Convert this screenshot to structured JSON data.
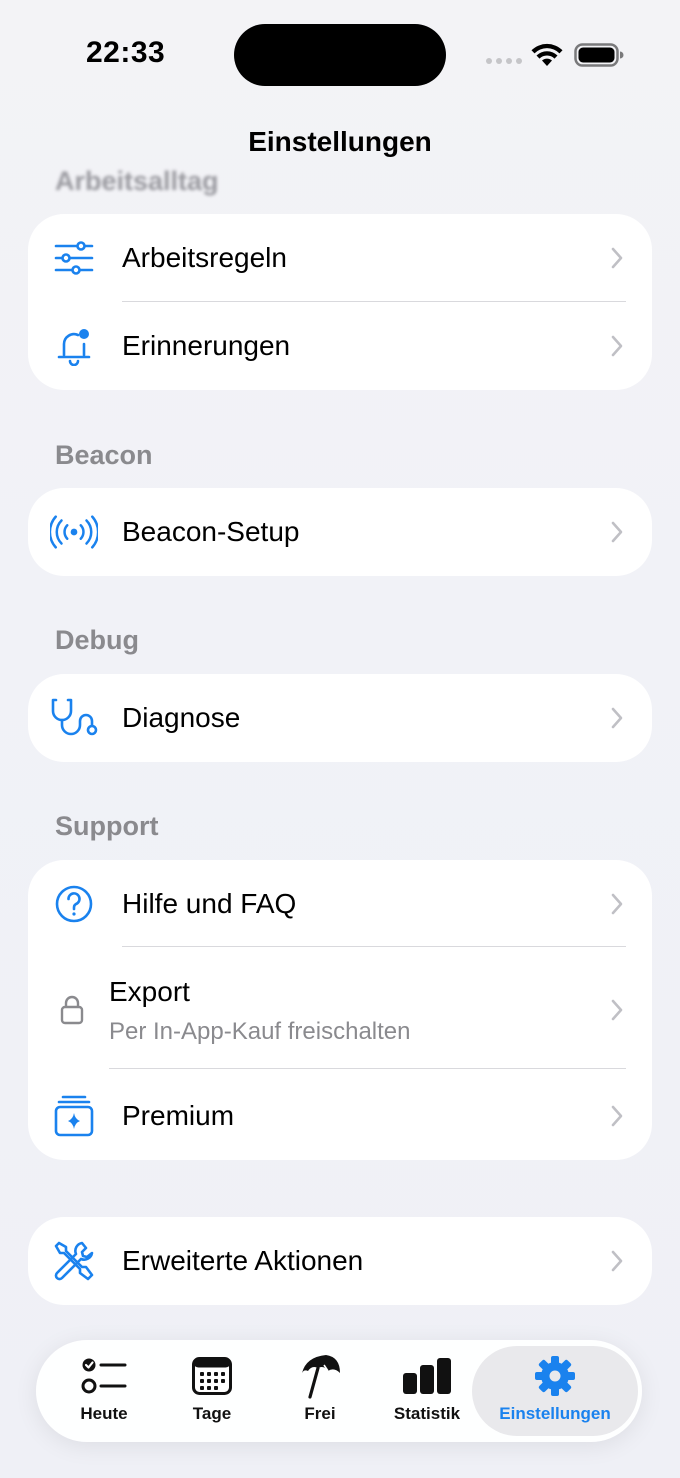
{
  "status_bar": {
    "time": "22:33"
  },
  "nav": {
    "title": "Einstellungen"
  },
  "sections": {
    "arbeitsalltag": {
      "header": "Arbeitsalltag",
      "rows": [
        {
          "label": "Arbeitsregeln",
          "icon": "sliders-icon"
        },
        {
          "label": "Erinnerungen",
          "icon": "bell-badge-icon"
        }
      ]
    },
    "beacon": {
      "header": "Beacon",
      "rows": [
        {
          "label": "Beacon-Setup",
          "icon": "broadcast-icon"
        }
      ]
    },
    "debug": {
      "header": "Debug",
      "rows": [
        {
          "label": "Diagnose",
          "icon": "stethoscope-icon"
        }
      ]
    },
    "support": {
      "header": "Support",
      "rows": [
        {
          "label": "Hilfe und FAQ",
          "icon": "question-circle-icon"
        },
        {
          "label": "Export",
          "sublabel": "Per In-App-Kauf freischalten",
          "icon": "lock-icon"
        },
        {
          "label": "Premium",
          "icon": "sparkle-stack-icon"
        }
      ]
    },
    "advanced": {
      "rows": [
        {
          "label": "Erweiterte Aktionen",
          "icon": "tools-icon"
        }
      ]
    }
  },
  "tab_bar": {
    "tabs": [
      {
        "label": "Heute",
        "icon": "checklist-icon",
        "active": false
      },
      {
        "label": "Tage",
        "icon": "calendar-icon",
        "active": false
      },
      {
        "label": "Frei",
        "icon": "beach-umbrella-icon",
        "active": false
      },
      {
        "label": "Statistik",
        "icon": "bar-chart-icon",
        "active": false
      },
      {
        "label": "Einstellungen",
        "icon": "gear-icon",
        "active": true
      }
    ]
  },
  "colors": {
    "accent": "#1a82ee",
    "secondary_text": "#8a8a8e",
    "card": "#ffffff"
  }
}
